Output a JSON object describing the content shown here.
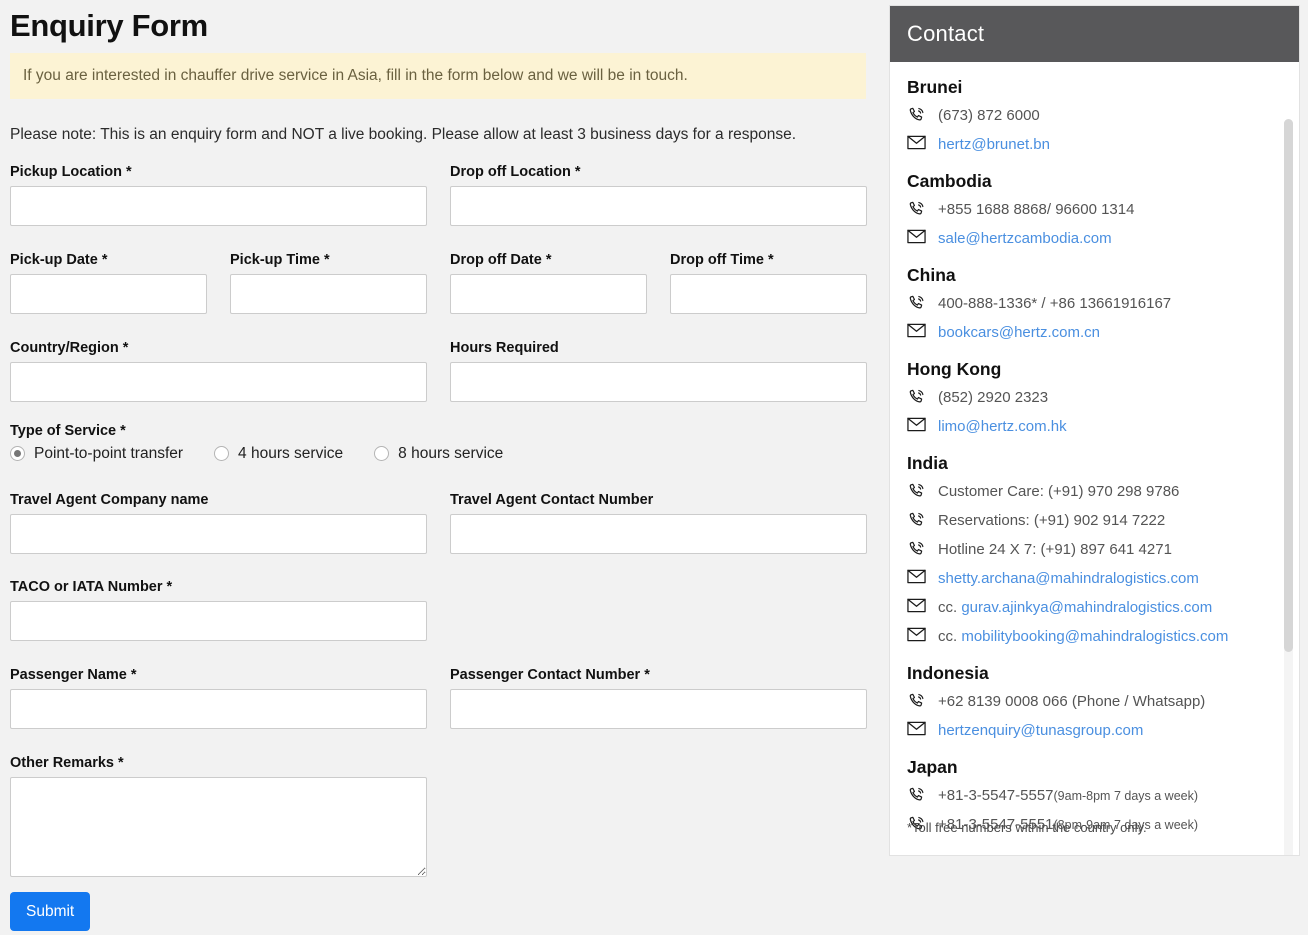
{
  "form": {
    "title": "Enquiry Form",
    "notice": "If you are interested in chauffer drive service in Asia, fill in the form below and we will be in touch.",
    "note": "Please note: This is an enquiry form and NOT a live booking. Please allow at least 3 business days for a response.",
    "fields": {
      "pickup_location": {
        "label": "Pickup Location *",
        "value": "",
        "placeholder": ""
      },
      "dropoff_location": {
        "label": "Drop off Location *",
        "value": "",
        "placeholder": ""
      },
      "pickup_date": {
        "label": "Pick-up Date *",
        "value": "",
        "placeholder": ""
      },
      "pickup_time": {
        "label": "Pick-up Time *",
        "value": "",
        "placeholder": ""
      },
      "dropoff_date": {
        "label": "Drop off Date *",
        "value": "",
        "placeholder": ""
      },
      "dropoff_time": {
        "label": "Drop off Time *",
        "value": "",
        "placeholder": ""
      },
      "country_region": {
        "label": "Country/Region *",
        "value": "",
        "placeholder": ""
      },
      "hours_required": {
        "label": "Hours Required",
        "value": "",
        "placeholder": ""
      },
      "type_of_service": {
        "label": "Type of Service *"
      },
      "travel_agent_company": {
        "label": "Travel Agent Company name",
        "value": "",
        "placeholder": ""
      },
      "travel_agent_contact": {
        "label": "Travel Agent Contact Number",
        "value": "",
        "placeholder": ""
      },
      "taco_iata": {
        "label": "TACO or IATA Number *",
        "value": "",
        "placeholder": ""
      },
      "passenger_name": {
        "label": "Passenger Name *",
        "value": "",
        "placeholder": ""
      },
      "passenger_contact": {
        "label": "Passenger Contact Number *",
        "value": "",
        "placeholder": ""
      },
      "other_remarks": {
        "label": "Other Remarks *",
        "value": "",
        "placeholder": ""
      }
    },
    "service_options": [
      {
        "label": "Point-to-point transfer",
        "checked": true
      },
      {
        "label": "4 hours service",
        "checked": false
      },
      {
        "label": "8 hours service",
        "checked": false
      }
    ],
    "submit_label": "Submit",
    "colors": {
      "submit_bg": "#1378f0",
      "notice_bg": "#fcf3d4",
      "page_bg": "#f2f2f2"
    }
  },
  "contact": {
    "header": "Contact",
    "footnote": "*Toll free numbers within the country only.",
    "colors": {
      "header_bg": "#58585a",
      "link": "#4a8fe0",
      "text": "#545454"
    },
    "countries": [
      {
        "name": "Brunei",
        "lines": [
          {
            "icon": "phone-icon",
            "type": "phone",
            "text": "(673) 872 6000"
          },
          {
            "icon": "envelope-icon",
            "type": "email",
            "text": "hertz@brunet.bn"
          }
        ]
      },
      {
        "name": "Cambodia",
        "lines": [
          {
            "icon": "phone-icon",
            "type": "phone",
            "text": "+855 1688 8868/ 96600 1314"
          },
          {
            "icon": "envelope-icon",
            "type": "email",
            "text": "sale@hertzcambodia.com"
          }
        ]
      },
      {
        "name": "China",
        "lines": [
          {
            "icon": "phone-icon",
            "type": "phone",
            "text": "400-888-1336* / +86 13661916167"
          },
          {
            "icon": "envelope-icon",
            "type": "email",
            "text": "bookcars@hertz.com.cn"
          }
        ]
      },
      {
        "name": "Hong Kong",
        "lines": [
          {
            "icon": "phone-icon",
            "type": "phone",
            "text": "(852) 2920 2323"
          },
          {
            "icon": "envelope-icon",
            "type": "email",
            "text": "limo@hertz.com.hk"
          }
        ]
      },
      {
        "name": "India",
        "lines": [
          {
            "icon": "phone-icon",
            "type": "phone",
            "text": "Customer Care: (+91) 970 298 9786"
          },
          {
            "icon": "phone-icon",
            "type": "phone",
            "text": "Reservations: (+91) 902 914 7222"
          },
          {
            "icon": "phone-icon",
            "type": "phone",
            "text": "Hotline 24 X 7: (+91) 897 641 4271"
          },
          {
            "icon": "envelope-icon",
            "type": "email",
            "text": "shetty.archana@mahindralogistics.com"
          },
          {
            "icon": "envelope-icon",
            "type": "email",
            "prefix": "cc. ",
            "text": "gurav.ajinkya@mahindralogistics.com"
          },
          {
            "icon": "envelope-icon",
            "type": "email",
            "prefix": "cc. ",
            "text": "mobilitybooking@mahindralogistics.com"
          }
        ]
      },
      {
        "name": "Indonesia",
        "lines": [
          {
            "icon": "phone-icon",
            "type": "phone",
            "text": "+62 8139 0008 066 (Phone / Whatsapp)"
          },
          {
            "icon": "envelope-icon",
            "type": "email",
            "text": "hertzenquiry@tunasgroup.com"
          }
        ]
      },
      {
        "name": "Japan",
        "lines": [
          {
            "icon": "phone-icon",
            "type": "phone",
            "text": "+81-3-5547-5557",
            "small": "(9am-8pm 7 days a week)"
          },
          {
            "icon": "phone-icon",
            "type": "phone",
            "text": "+81-3-5547-5551",
            "small": "(8pm-9am 7 days a week)"
          }
        ]
      }
    ]
  }
}
